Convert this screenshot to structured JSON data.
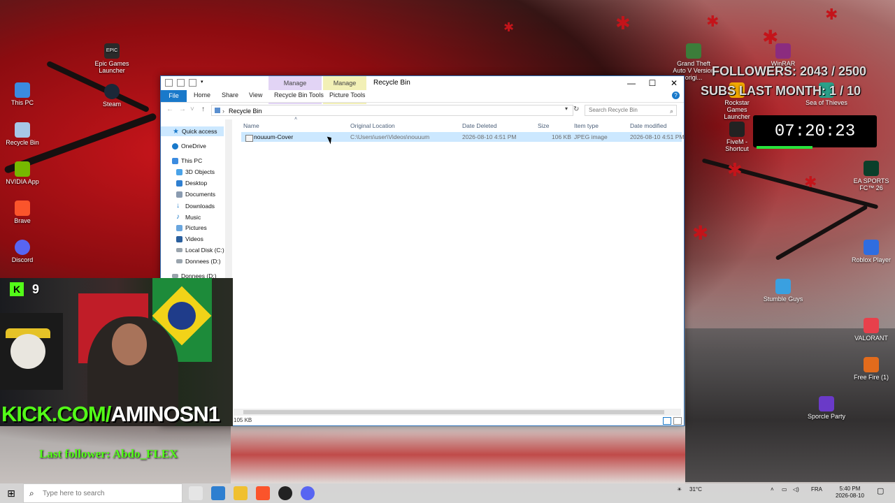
{
  "colors": {
    "accent": "#1979ca",
    "selection": "#cce8ff",
    "kick_green": "#53fc18",
    "recycle_tab": "#e2d4f5",
    "picture_tab": "#f2f0b6"
  },
  "desktop_left": [
    {
      "label": "Epic Games Launcher",
      "icon": "epic-games-icon",
      "color": "#2a2a2a"
    },
    {
      "label": "This PC",
      "icon": "computer-icon",
      "color": "#3b8be0"
    },
    {
      "label": "Steam",
      "icon": "steam-icon",
      "color": "#1b2838"
    },
    {
      "label": "Recycle Bin",
      "icon": "recycle-bin-icon",
      "color": "#a7c7e7"
    },
    {
      "label": "NVIDIA App",
      "icon": "nvidia-icon",
      "color": "#76b900"
    },
    {
      "label": "Brave",
      "icon": "brave-icon",
      "color": "#fb542b"
    },
    {
      "label": "Discord",
      "icon": "discord-icon",
      "color": "#5865f2"
    }
  ],
  "desktop_right": [
    {
      "label": "Grand Theft Auto V Version origi...",
      "icon": "gta-icon",
      "color": "#3c7d3a"
    },
    {
      "label": "WinRAR",
      "icon": "winrar-icon",
      "color": "#8b2c7f"
    },
    {
      "label": "Rockstar Games Launcher",
      "icon": "rockstar-icon",
      "color": "#f2a900"
    },
    {
      "label": "Sea of Thieves",
      "icon": "sea-of-thieves-icon",
      "color": "#2aa08a"
    },
    {
      "label": "FiveM - Shortcut",
      "icon": "fivem-icon",
      "color": "#222"
    },
    {
      "label": "EA SPORTS FC™ 26",
      "icon": "ea-fc-icon",
      "color": "#0b3f2a"
    },
    {
      "label": "Roblox Player",
      "icon": "roblox-icon",
      "color": "#2f6de0"
    },
    {
      "label": "Stumble Guys",
      "icon": "stumble-guys-icon",
      "color": "#3aa0e0"
    },
    {
      "label": "VALORANT",
      "icon": "valorant-icon",
      "color": "#e8404b"
    },
    {
      "label": "Free Fire (1)",
      "icon": "free-fire-icon",
      "color": "#e26b1c"
    },
    {
      "label": "Sporcle Party",
      "icon": "sporcle-icon",
      "color": "#6a3ac8"
    }
  ],
  "stream": {
    "followers": "FOLLOWERS: 2043 / 2500",
    "subs": "SUBS LAST MONTH: 1 / 10",
    "timer": "07:20:23",
    "kick_prefix": "KICK.COM/",
    "kick_handle": "AMINOSN1",
    "last_follower": "Last follower: Abdo_FLEX",
    "badge_k": "K",
    "badge_9": "9"
  },
  "window": {
    "title": "Recycle Bin",
    "context_tabs": [
      {
        "header": "Manage",
        "label": "Recycle Bin Tools"
      },
      {
        "header": "Manage",
        "label": "Picture Tools"
      }
    ],
    "ribbon_tabs": [
      "File",
      "Home",
      "Share",
      "View"
    ],
    "address": "Recycle Bin",
    "search_placeholder": "Search Recycle Bin",
    "nav": {
      "quick_access": "Quick access",
      "onedrive": "OneDrive",
      "this_pc": "This PC",
      "objects3d": "3D Objects",
      "desktop": "Desktop",
      "documents": "Documents",
      "downloads": "Downloads",
      "music": "Music",
      "pictures": "Pictures",
      "videos": "Videos",
      "local_disk": "Local Disk (C:)",
      "donnees": "Donnees (D:)",
      "donnees2": "Donnees (D:)"
    },
    "columns": [
      "Name",
      "Original Location",
      "Date Deleted",
      "Size",
      "Item type",
      "Date modified"
    ],
    "rows": [
      {
        "name": "nouuum-Cover",
        "location": "C:\\Users\\user\\Videos\\nouuum",
        "deleted": "2026-08-10 4:51 PM",
        "size": "106 KB",
        "type": "JPEG image",
        "modified": "2026-08-10 4:51 PM"
      }
    ],
    "status": "105 KB"
  },
  "taskbar": {
    "search_placeholder": "Type here to search",
    "weather": "31°C",
    "lang": "FRA",
    "time": "5:40 PM",
    "date": "2026-08-10"
  }
}
